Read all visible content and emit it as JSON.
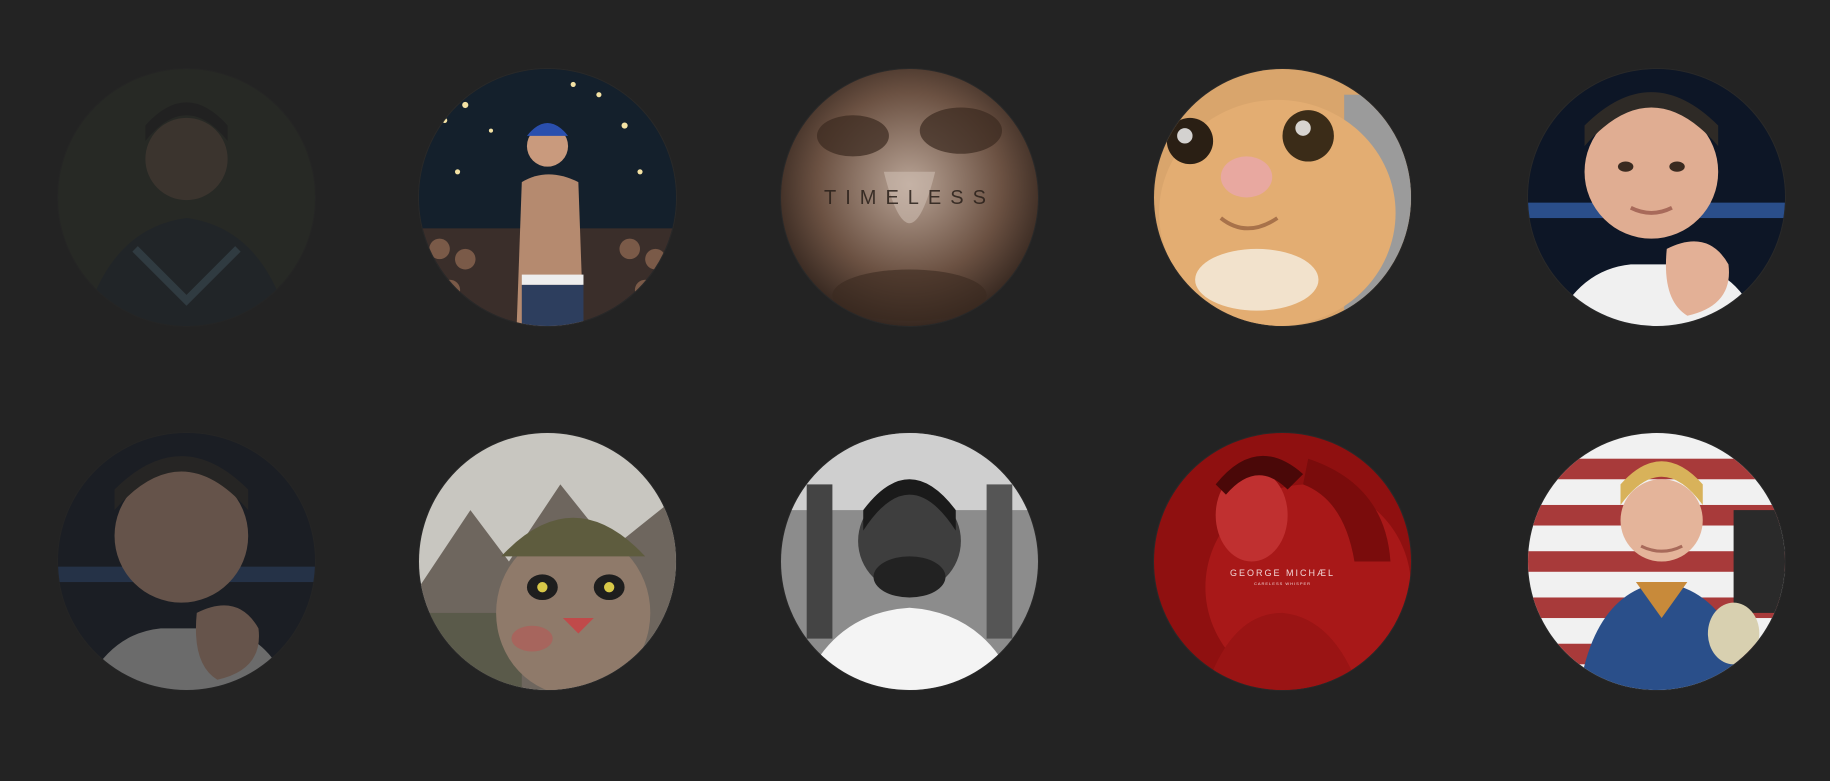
{
  "avatars": [
    {
      "row": 1,
      "col": 1,
      "subject": "man-in-dark-jacket",
      "state": "dimmed"
    },
    {
      "row": 1,
      "col": 2,
      "subject": "tattooed-performer-on-stage",
      "state": "normal"
    },
    {
      "row": 1,
      "col": 3,
      "subject": "timeless-album-cover",
      "state": "normal",
      "cover_text": "TIMELESS"
    },
    {
      "row": 1,
      "col": 4,
      "subject": "orange-cat-closeup",
      "state": "normal"
    },
    {
      "row": 1,
      "col": 5,
      "subject": "boy-chin-on-hand",
      "state": "normal"
    },
    {
      "row": 2,
      "col": 1,
      "subject": "boy-chin-on-hand",
      "state": "dimmed"
    },
    {
      "row": 2,
      "col": 2,
      "subject": "cat-in-soldier-helmet",
      "state": "normal"
    },
    {
      "row": 2,
      "col": 3,
      "subject": "man-eyes-closed-bw",
      "state": "normal"
    },
    {
      "row": 2,
      "col": 4,
      "subject": "careless-whisper-cover",
      "state": "normal",
      "cover_text": "GEORGE MICHÆL",
      "cover_subtext": "CARELESS WHISPER"
    },
    {
      "row": 2,
      "col": 5,
      "subject": "blond-hero-flag",
      "state": "normal"
    }
  ],
  "colors": {
    "background": "#232323"
  }
}
